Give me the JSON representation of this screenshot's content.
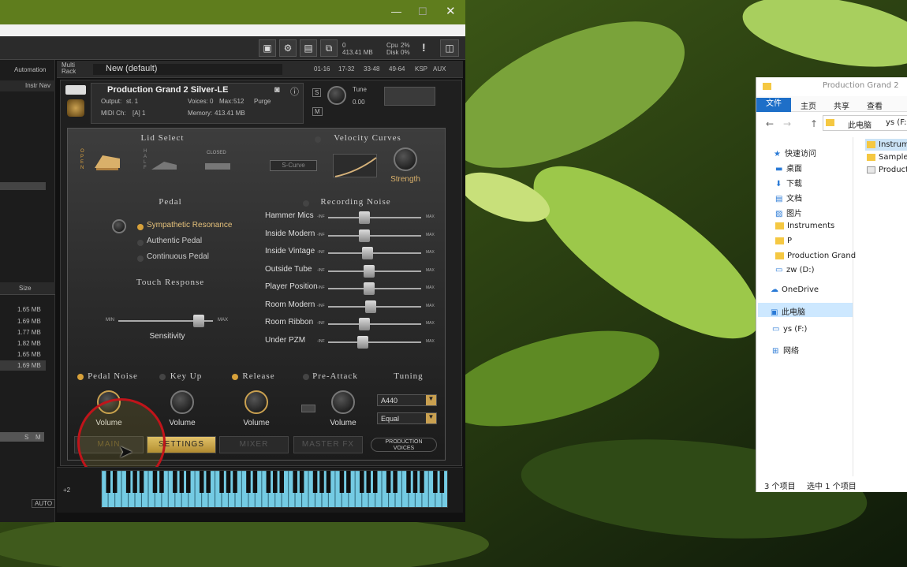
{
  "kontakt": {
    "multi_rack_label": "Multi\nRack",
    "multi_name": "New (default)",
    "page_ranges": [
      "01-16",
      "17-32",
      "33-48",
      "49-64"
    ],
    "ksp": "KSP",
    "aux": "AUX",
    "cpu_label": "Cpu",
    "cpu_value": "2%",
    "disk_label": "Disk",
    "disk_value": "0%",
    "mem_value": "413.41 MB",
    "voices_counter": "0",
    "warn": "!",
    "left_tabs": {
      "automation": "Automation",
      "instr_nav": "Instr Nav"
    },
    "size_header": "Size",
    "sizes": [
      "1.65 MB",
      "1.69 MB",
      "1.77 MB",
      "1.82 MB",
      "1.65 MB",
      "1.69 MB"
    ],
    "auto": "AUTO",
    "sm": [
      "S",
      "M"
    ],
    "instrument": {
      "name": "Production Grand 2 Silver-LE",
      "output_label": "Output:",
      "output_value": "st. 1",
      "voices_label": "Voices:",
      "voices_value": "0",
      "max_label": "Max:",
      "max_value": "512",
      "purge": "Purge",
      "midi_label": "MIDI Ch:",
      "midi_value": "[A] 1",
      "memory_label": "Memory:",
      "memory_value": "413.41 MB",
      "tune_label": "Tune",
      "tune_value": "0.00",
      "s": "S",
      "m": "M"
    },
    "lid_select": {
      "title": "Lid Select",
      "open": "OPEN",
      "half": "HALF",
      "closed": "CLOSED"
    },
    "velocity": {
      "title": "Velocity Curves",
      "curve": "S-Curve",
      "strength": "Strength"
    },
    "pedal": {
      "title": "Pedal",
      "options": [
        "Sympathetic Resonance",
        "Authentic Pedal",
        "Continuous Pedal"
      ]
    },
    "recording_noise": {
      "title": "Recording Noise",
      "min": "-INF",
      "max": "MAX",
      "rows": [
        {
          "label": "Hammer Mics",
          "value": 0.39
        },
        {
          "label": "Inside Modern",
          "value": 0.39
        },
        {
          "label": "Inside Vintage",
          "value": 0.42
        },
        {
          "label": "Outside Tube",
          "value": 0.44
        },
        {
          "label": "Player Position",
          "value": 0.44
        },
        {
          "label": "Room Modern",
          "value": 0.46
        },
        {
          "label": "Room Ribbon",
          "value": 0.39
        },
        {
          "label": "Under PZM",
          "value": 0.37
        }
      ]
    },
    "touch": {
      "title": "Touch Response",
      "min": "MIN",
      "max": "MAX",
      "label": "Sensitivity",
      "value": 0.85
    },
    "bottom": {
      "pedal_noise": "Pedal Noise",
      "key_up": "Key Up",
      "release": "Release",
      "pre_attack": "Pre-Attack",
      "tuning": "Tuning",
      "volume": "Volume",
      "tuning_a": "A440",
      "tuning_b": "Equal"
    },
    "tabs": [
      "MAIN",
      "SETTINGS",
      "MIXER",
      "MASTER FX"
    ],
    "brand": "PRODUCTION\nVOICES",
    "octave": "+2"
  },
  "explorer": {
    "title": "Production Grand 2",
    "ribbon": [
      "文件",
      "主页",
      "共享",
      "查看"
    ],
    "path": [
      "此电脑",
      "ys (F:)"
    ],
    "nav": [
      {
        "label": "快速访问",
        "kind": "star"
      },
      {
        "label": "桌面",
        "kind": "desk"
      },
      {
        "label": "下载",
        "kind": "down"
      },
      {
        "label": "文档",
        "kind": "doc"
      },
      {
        "label": "图片",
        "kind": "pic"
      },
      {
        "label": "Instruments",
        "kind": "folder"
      },
      {
        "label": "P",
        "kind": "folder"
      },
      {
        "label": "Production Grand",
        "kind": "folder"
      },
      {
        "label": "zw (D:)",
        "kind": "drive"
      },
      {
        "label": "OneDrive",
        "kind": "cloud"
      },
      {
        "label": "此电脑",
        "kind": "pc"
      },
      {
        "label": "ys (F:)",
        "kind": "drive"
      },
      {
        "label": "网络",
        "kind": "net"
      }
    ],
    "files": [
      "Instrume",
      "Samples",
      "Producti"
    ],
    "status_count": "3 个项目",
    "status_sel": "选中 1 个项目"
  }
}
